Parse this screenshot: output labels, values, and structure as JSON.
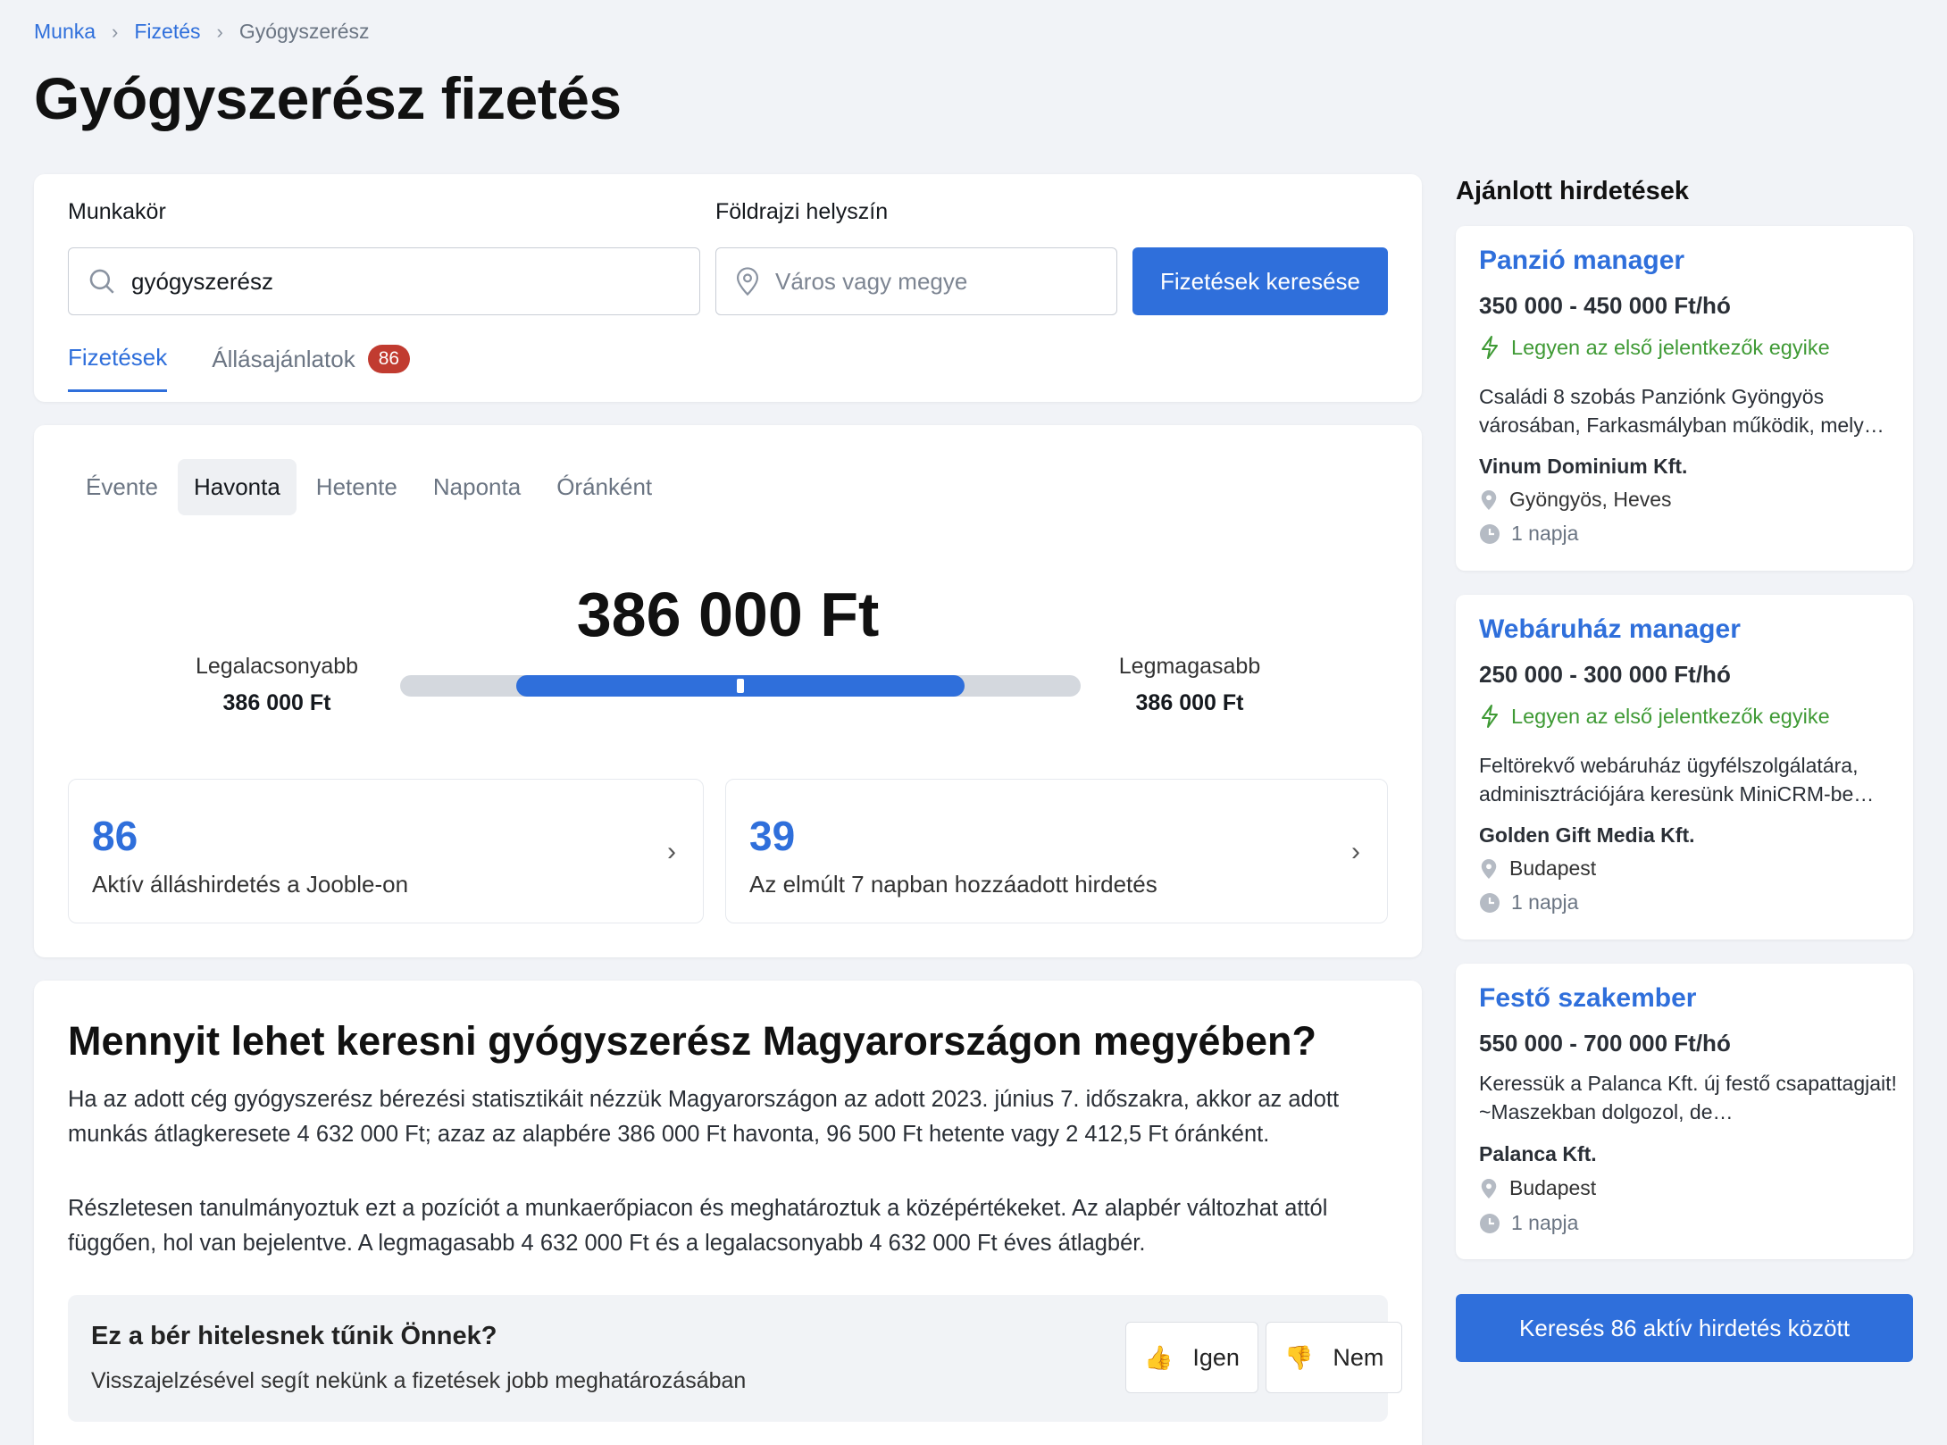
{
  "breadcrumb": {
    "items": [
      "Munka",
      "Fizetés"
    ],
    "current": "Gyógyszerész"
  },
  "page_title": "Gyógyszerész fizetés",
  "search": {
    "job_label": "Munkakör",
    "job_value": "gyógyszerész",
    "location_label": "Földrajzi helyszín",
    "location_placeholder": "Város vagy megye",
    "button": "Fizetések keresése"
  },
  "tabs": [
    {
      "label": "Fizetések",
      "active": true
    },
    {
      "label": "Állásajánlatok",
      "badge": "86"
    }
  ],
  "periods": [
    "Évente",
    "Havonta",
    "Hetente",
    "Naponta",
    "Óránként"
  ],
  "active_period": "Havonta",
  "salary": {
    "value": "386 000 Ft",
    "low_label": "Legalacsonyabb",
    "low_value": "386 000 Ft",
    "high_label": "Legmagasabb",
    "high_value": "386 000 Ft",
    "range_fill_start": 0.17,
    "range_fill_end": 0.83,
    "marker_position": 0.5
  },
  "stats": [
    {
      "number": "86",
      "text": "Aktív álláshirdetés a Jooble-on"
    },
    {
      "number": "39",
      "text": "Az elmúlt 7 napban hozzáadott hirdetés"
    }
  ],
  "article": {
    "title": "Mennyit lehet keresni gyógyszerész Magyarországon megyében?",
    "p1": "Ha az adott cég gyógyszerész bérezési statisztikáit nézzük Magyarországon az adott 2023. június 7. időszakra, akkor az adott munkás átlagkeresete 4 632 000 Ft; azaz az alapbére 386 000 Ft havonta, 96 500 Ft hetente vagy 2 412,5 Ft óránként.",
    "p2": "Részletesen tanulmányoztuk ezt a pozíciót a munkaerőpiacon és meghatároztuk a középértékeket. Az alapbér változhat attól függően, hol van bejelentve. A legmagasabb 4 632 000 Ft és a legalacsonyabb 4 632 000 Ft éves átlagbér."
  },
  "feedback": {
    "title": "Ez a bér hitelesnek tűnik Önnek?",
    "subtitle": "Visszajelzésével segít nekünk a fizetések jobb meghatározásában",
    "yes": "Igen",
    "no": "Nem",
    "yes_emoji": "👍",
    "no_emoji": "👎"
  },
  "sidebar": {
    "title": "Ajánlott hirdetések",
    "jobs": [
      {
        "title": "Panzió manager",
        "salary": "350 000 - 450 000 Ft/hó",
        "first": "Legyen az első jelentkezők egyike",
        "desc": "Családi 8 szobás Panziónk Gyöngyös városában, Farkasmályban működik, mely…",
        "company": "Vinum Dominium Kft.",
        "location": "Gyöngyös, Heves",
        "age": "1 napja"
      },
      {
        "title": "Webáruház manager",
        "salary": "250 000 - 300 000 Ft/hó",
        "first": "Legyen az első jelentkezők egyike",
        "desc": "Feltörekvő webáruház ügyfélszolgálatára, adminisztrációjára keresünk MiniCRM-be…",
        "company": "Golden Gift Media Kft.",
        "location": "Budapest",
        "age": "1 napja"
      },
      {
        "title": "Festő szakember",
        "salary": "550 000 - 700 000 Ft/hó",
        "desc": "Keressük a Palanca Kft. új festő csapattagjait! ~Maszekban dolgozol, de…",
        "company": "Palanca Kft.",
        "location": "Budapest",
        "age": "1 napja"
      }
    ],
    "button": "Keresés 86 aktív hirdetés között"
  },
  "colors": {
    "accent": "#2f6fdb",
    "badge": "#c13b30",
    "green": "#3f9a35"
  }
}
